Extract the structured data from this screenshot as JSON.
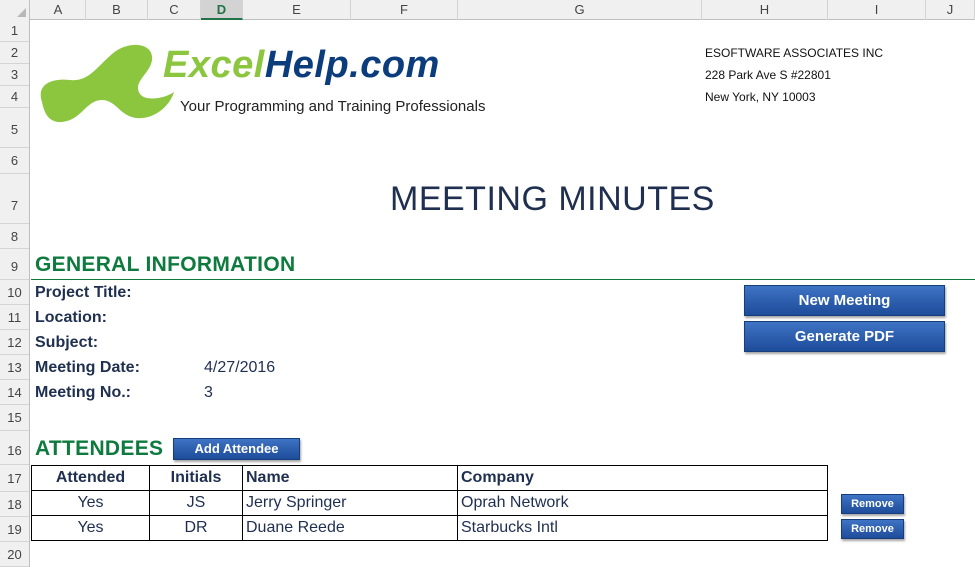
{
  "columns": [
    "A",
    "B",
    "C",
    "D",
    "E",
    "F",
    "G",
    "H",
    "I",
    "J"
  ],
  "selected_columns": [
    "D"
  ],
  "rows": [
    "1",
    "2",
    "3",
    "4",
    "5",
    "6",
    "7",
    "8",
    "9",
    "10",
    "11",
    "12",
    "13",
    "14",
    "15",
    "16",
    "17",
    "18",
    "19",
    "20"
  ],
  "logo": {
    "excel": "Excel",
    "help": "Help.com",
    "tagline": "Your Programming and Training Professionals"
  },
  "company": {
    "name": "ESOFTWARE ASSOCIATES INC",
    "address": "228 Park Ave S #22801",
    "city": "New York, NY 10003"
  },
  "title": "MEETING MINUTES",
  "general": {
    "heading": "GENERAL INFORMATION",
    "fields": [
      {
        "label": "Project Title:",
        "value": ""
      },
      {
        "label": "Location:",
        "value": ""
      },
      {
        "label": "Subject:",
        "value": ""
      },
      {
        "label": "Meeting Date:",
        "value": "4/27/2016"
      },
      {
        "label": "Meeting No.:",
        "value": "3"
      }
    ]
  },
  "buttons": {
    "new_meeting": "New Meeting",
    "generate_pdf": "Generate PDF",
    "add_attendee": "Add Attendee",
    "remove": "Remove"
  },
  "attendees": {
    "heading": "ATTENDEES",
    "headers": {
      "attended": "Attended",
      "initials": "Initials",
      "name": "Name",
      "company": "Company"
    },
    "rows": [
      {
        "attended": "Yes",
        "initials": "JS",
        "name": "Jerry Springer",
        "company": "Oprah Network"
      },
      {
        "attended": "Yes",
        "initials": "DR",
        "name": "Duane Reede",
        "company": "Starbucks Intl"
      }
    ]
  },
  "colors": {
    "accent_green": "#0e7a3e",
    "button_blue": "#1d4c9a",
    "logo_green": "#8cc63f",
    "logo_navy": "#0b3c7c"
  }
}
